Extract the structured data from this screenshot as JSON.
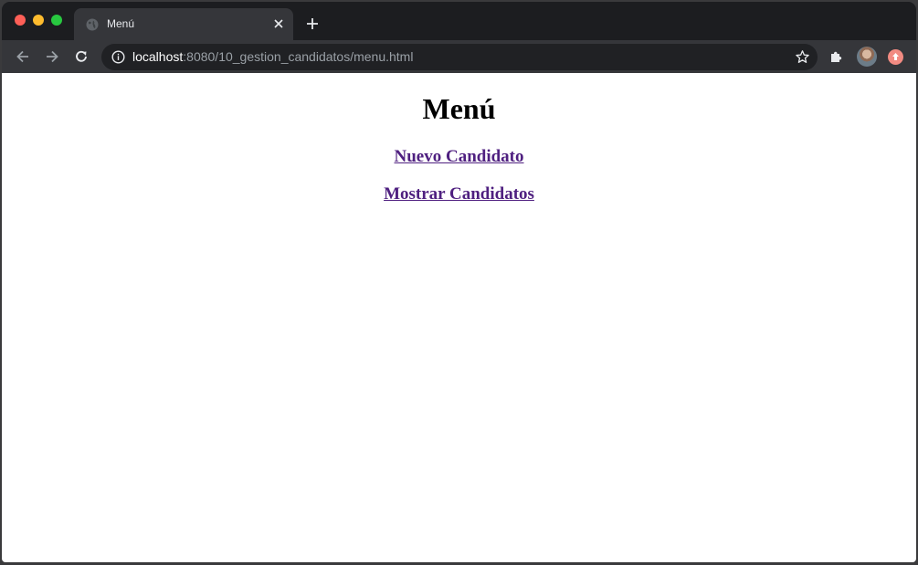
{
  "browser": {
    "tab_title": "Menú",
    "url_host": "localhost",
    "url_path": ":8080/10_gestion_candidatos/menu.html",
    "icons": {
      "favicon": "globe-icon",
      "tab_close": "close-icon",
      "new_tab": "plus-icon",
      "back": "arrow-left-icon",
      "forward": "arrow-right-icon",
      "reload": "reload-icon",
      "site_info": "info-icon",
      "bookmark": "star-icon",
      "extensions": "puzzle-icon",
      "profile": "avatar",
      "update": "update-icon"
    },
    "colors": {
      "frame": "#202124",
      "toolbar": "#35363a",
      "close": "#fe5f57",
      "minimize": "#febc2e",
      "maximize": "#28c840"
    }
  },
  "page": {
    "heading": "Menú",
    "links": [
      {
        "label": "Nuevo Candidato"
      },
      {
        "label": "Mostrar Candidatos"
      }
    ],
    "colors": {
      "link": "#4f2080",
      "background": "#ffffff"
    }
  }
}
